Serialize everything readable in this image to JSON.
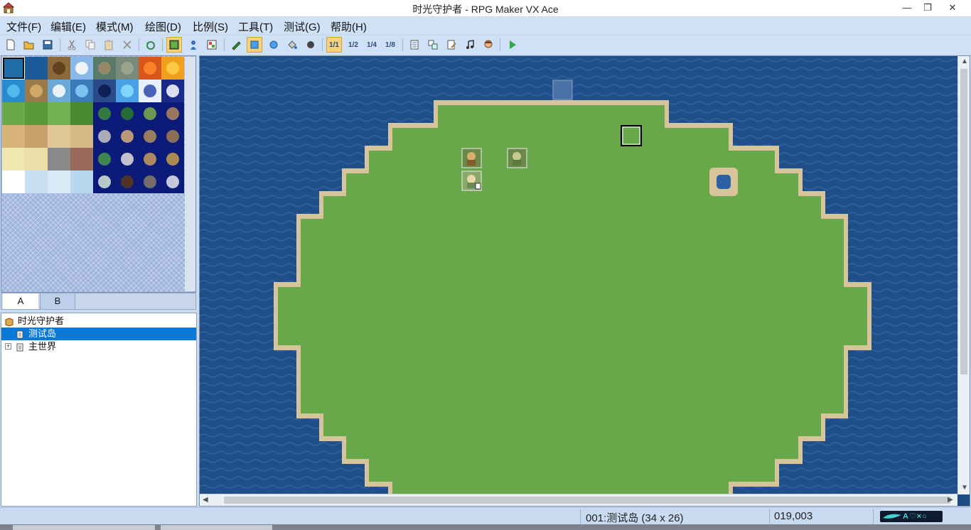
{
  "window": {
    "title": "时光守护者 - RPG Maker VX Ace",
    "app_icon": "rpgmaker-house-icon",
    "controls": [
      "minimize-icon",
      "restore-icon",
      "close-icon"
    ]
  },
  "menu": [
    {
      "label": "文件(F)"
    },
    {
      "label": "编辑(E)"
    },
    {
      "label": "模式(M)"
    },
    {
      "label": "绘图(D)"
    },
    {
      "label": "比例(S)"
    },
    {
      "label": "工具(T)"
    },
    {
      "label": "测试(G)"
    },
    {
      "label": "帮助(H)"
    }
  ],
  "toolbar": {
    "scale_labels": [
      "1/1",
      "1/2",
      "1/4",
      "1/8"
    ],
    "buttons": [
      "new-project-icon",
      "open-project-icon",
      "save-project-icon",
      "cut-icon",
      "copy-icon",
      "paste-icon",
      "delete-icon",
      "undo-icon",
      "map-mode-icon",
      "event-mode-icon",
      "region-mode-icon",
      "pencil-icon",
      "rectangle-icon",
      "ellipse-icon",
      "flood-fill-icon",
      "shadow-pen-icon",
      "scale-1-1-icon",
      "scale-1-2-icon",
      "scale-1-4-icon",
      "scale-1-8-icon",
      "database-icon",
      "resource-manager-icon",
      "script-editor-icon",
      "sound-test-icon",
      "character-generator-icon",
      "playtest-icon"
    ]
  },
  "palette": {
    "tabs": [
      "A",
      "B"
    ],
    "active_tab": "A"
  },
  "map_tree": {
    "project": "时光守护者",
    "maps": [
      {
        "name": "测试岛",
        "selected": true,
        "expandable": false
      },
      {
        "name": "主世界",
        "selected": false,
        "expandable": true
      }
    ]
  },
  "status": {
    "map_info": "001:测试岛 (34 x 26)",
    "coordinates": "019,003",
    "logo_text": "A♡×○"
  },
  "colors": {
    "ocean": "#1c4a82",
    "grass": "#69a84a",
    "sand": "#d8c49a",
    "selection": "#0a78d7",
    "toolbar_active": "#f6d27a"
  }
}
